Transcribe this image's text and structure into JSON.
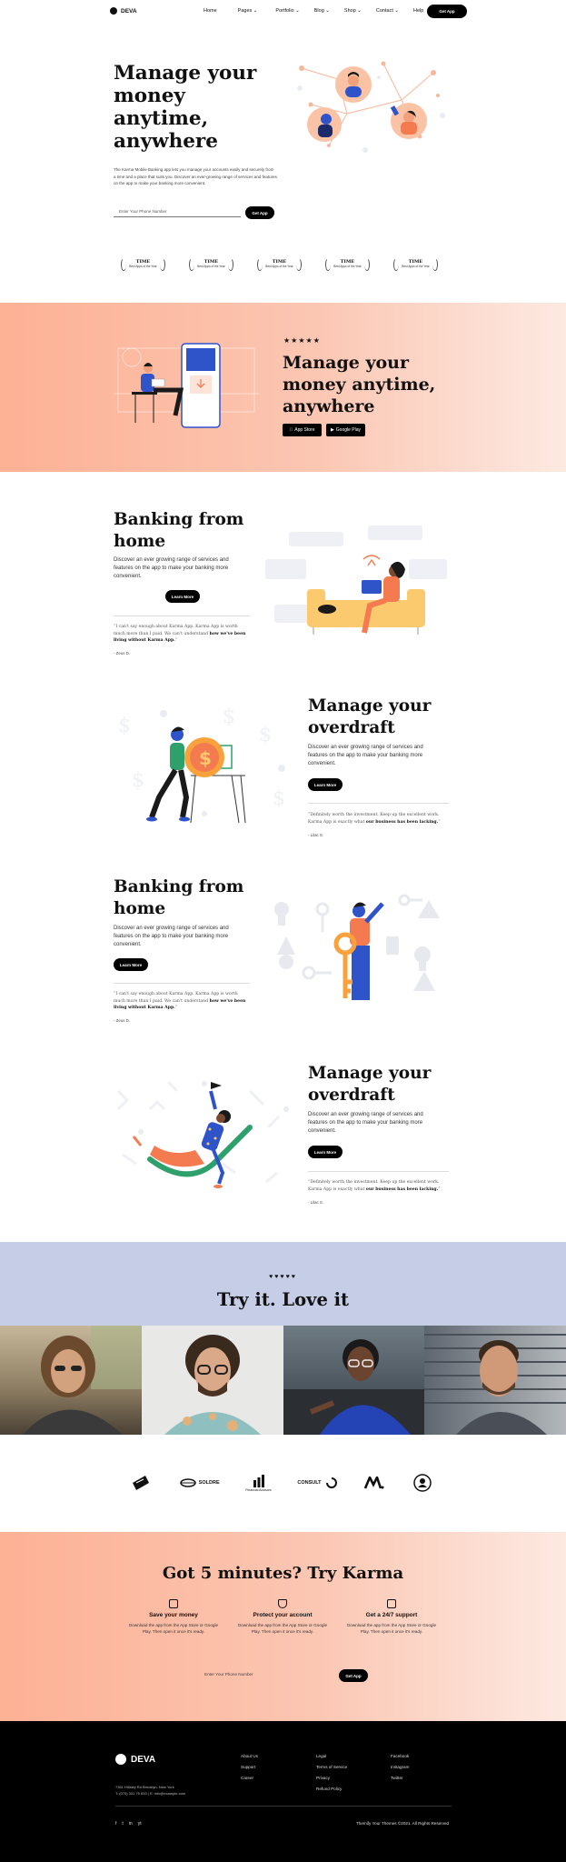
{
  "nav": {
    "logo": "DEVA",
    "items": [
      "Home",
      "Pages",
      "Portfolio",
      "Blog",
      "Shop",
      "Contact",
      "Help"
    ],
    "cta": "Get App"
  },
  "hero": {
    "title": "Manage your money anytime, anywhere",
    "description": "The Karma Mobile Banking app lets you manage your accounts easily and securely from a time and a place that suits you. Discover an ever-growing range of services and features on the app to make your banking more convenient.",
    "input_placeholder": "Enter Your Phone Number",
    "button": "Get App",
    "awards": [
      {
        "name": "TIME",
        "sub": "Best Apps of the Year"
      },
      {
        "name": "TIME",
        "sub": "Best Apps of the Year"
      },
      {
        "name": "TIME",
        "sub": "Best Apps of the Year"
      },
      {
        "name": "TIME",
        "sub": "Best Apps of the Year"
      },
      {
        "name": "TIME",
        "sub": "Best Apps of the Year"
      }
    ]
  },
  "promo": {
    "stars": "★★★★★",
    "title": "Manage your money anytime, anywhere",
    "app_store": "App Store",
    "google_play": "Google Play"
  },
  "features": [
    {
      "title": "Banking from home",
      "description": "Discover an ever growing range of services and features on the app to make your banking more convenient.",
      "button": "Learn More",
      "quote_plain": "“I can't say enough about Karma App. Karma App is worth much more than I paid. We can't understand ",
      "quote_bold": "how we've been living without Karma App.",
      "quote_end": "”",
      "author": "- Zeus D."
    },
    {
      "title": "Manage your overdraft",
      "description": "Discover an ever growing range of services and features on the app to make your banking more convenient.",
      "button": "Learn More",
      "quote_plain": "“Definitely worth the investment. Keep up the excellent work. Karma App is exactly what ",
      "quote_bold": "our business has been lacking.",
      "quote_end": "”",
      "author": "- Lilac S."
    },
    {
      "title": "Banking from home",
      "description": "Discover an ever growing range of services and features on the app to make your banking more convenient.",
      "button": "Learn More",
      "quote_plain": "“I can't say enough about Karma App. Karma App is worth much more than I paid. We can't understand ",
      "quote_bold": "how we've been living without Karma App.",
      "quote_end": "”",
      "author": "- Zeus D."
    },
    {
      "title": "Manage your overdraft",
      "description": "Discover an ever growing range of services and features on the app to make your banking more convenient.",
      "button": "Learn More",
      "quote_plain": "“Definitely worth the investment. Keep up the excellent work. Karma App is exactly what ",
      "quote_bold": "our business has been lacking.",
      "quote_end": "”",
      "author": "- Lilac S."
    }
  ],
  "tryit": {
    "hearts": "♥♥♥♥♥",
    "title": "Try it. Love it"
  },
  "brands": [
    "",
    "SOLDRE",
    "Financial Advisors",
    "CONSULT",
    "",
    ""
  ],
  "cta": {
    "title": "Got 5 minutes? Try Karma",
    "columns": [
      {
        "title": "Save your money",
        "desc": "Download the app from the App Store or Google Play. Then open it once it's ready."
      },
      {
        "title": "Protect your account",
        "desc": "Download the app from the App Store or Google Play. Then open it once it's ready."
      },
      {
        "title": "Get a 24/7 support",
        "desc": "Download the app from the App Store or Google Play. Then open it once it's ready."
      }
    ],
    "input_placeholder": "Enter Your Phone Number",
    "button": "Get App"
  },
  "footer": {
    "logo": "DEVA",
    "address_1": "7361 Hillsley Rd Brooklyn, New York",
    "address_2": "T: (070) 331 75 833 | E: info@example.com",
    "col1": [
      "About Us",
      "Support",
      "Career"
    ],
    "col2": [
      "Legal",
      "Terms of Service",
      "Privacy",
      "Refund Policy"
    ],
    "col3": [
      "Facebook",
      "Instagram",
      "Twitter"
    ],
    "socials": [
      "f",
      "t",
      "in",
      "yt"
    ],
    "copyright": "Themify Your Themes ©2021. All Rights Reserved"
  },
  "colors": {
    "accent_orange": "#f47b4f",
    "band_peach": "#fdb195",
    "band_blue": "#c5cde7",
    "dark": "#000000"
  }
}
